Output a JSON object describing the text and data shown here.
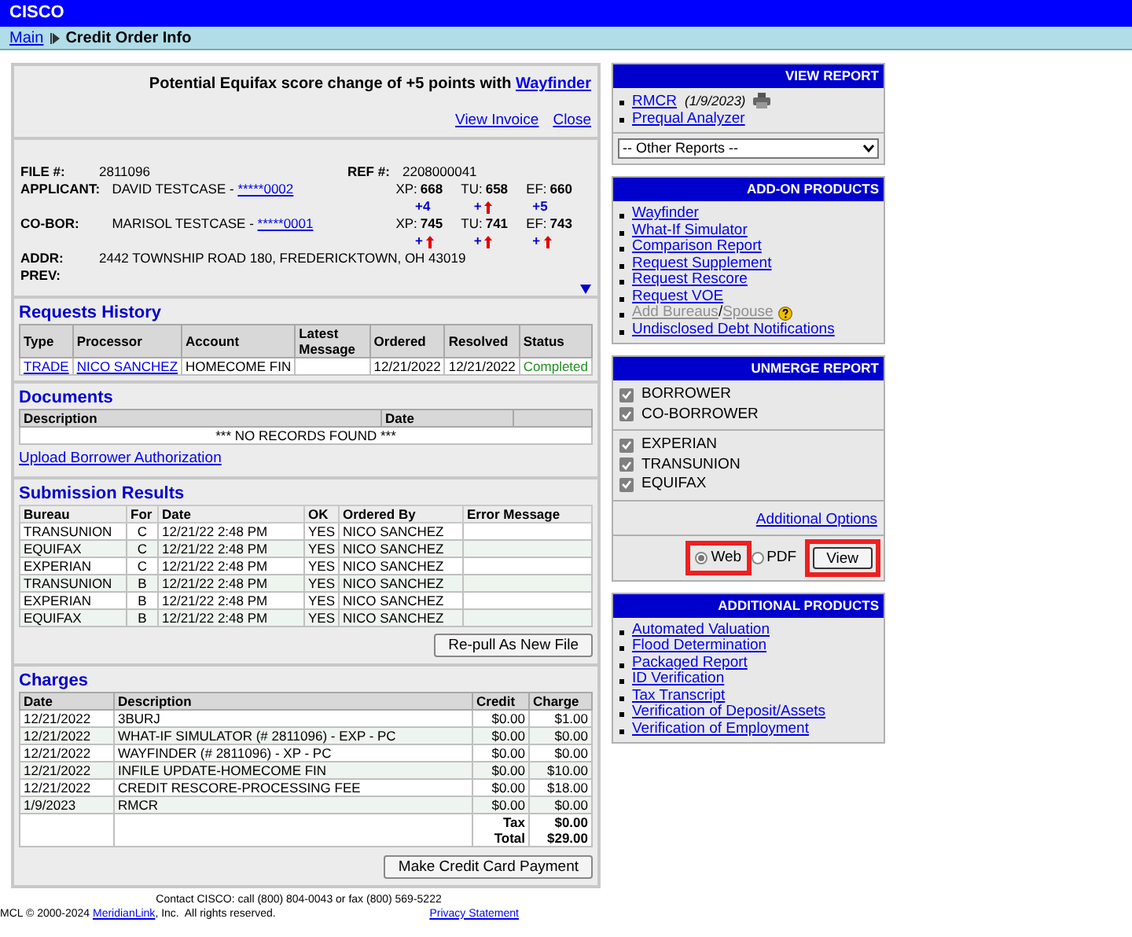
{
  "header": {
    "title": "CISCO"
  },
  "breadcrumb": {
    "link": "Main",
    "current": "Credit Order Info"
  },
  "promo": {
    "text": "Potential Equifax score change of +5 points with ",
    "link": "Wayfinder"
  },
  "top_links": [
    "View Invoice",
    "Close"
  ],
  "file": {
    "file_label": "FILE #:",
    "file": "2811096",
    "ref_label": "REF #:",
    "ref": "2208000041"
  },
  "borrowers": [
    {
      "label": "APPLICANT:",
      "name": "DAVID TESTCASE - ",
      "ssn": "*****0002",
      "scores": [
        {
          "bureau": "XP:",
          "score": "668",
          "change": "+4",
          "arrow": false
        },
        {
          "bureau": "TU:",
          "score": "658",
          "change": "+",
          "arrow": true
        },
        {
          "bureau": "EF:",
          "score": "660",
          "change": "+5",
          "arrow": false
        }
      ]
    },
    {
      "label": "CO-BOR:",
      "name": "MARISOL TESTCASE - ",
      "ssn": "*****0001",
      "scores": [
        {
          "bureau": "XP:",
          "score": "745",
          "change": "+",
          "arrow": true
        },
        {
          "bureau": "TU:",
          "score": "741",
          "change": "+",
          "arrow": true
        },
        {
          "bureau": "EF:",
          "score": "743",
          "change": "+",
          "arrow": true
        }
      ]
    }
  ],
  "addr": {
    "label": "ADDR:",
    "value": "2442 TOWNSHIP ROAD 180, FREDERICKTOWN, OH 43019",
    "prev_label": "PREV:"
  },
  "requests_history": {
    "title": "Requests History",
    "columns": [
      "Type",
      "Processor",
      "Account",
      "Latest Message",
      "Ordered",
      "Resolved",
      "Status"
    ],
    "rows": [
      {
        "type": "TRADE",
        "processor": "NICO SANCHEZ",
        "account": "HOMECOME FIN",
        "ordered": "12/21/2022",
        "resolved": "12/21/2022",
        "status": "Completed"
      }
    ]
  },
  "documents": {
    "title": "Documents",
    "columns": [
      "Description",
      "Date"
    ],
    "empty_message": "*** NO RECORDS FOUND ***",
    "link": "Upload Borrower Authorization"
  },
  "submission_results": {
    "title": "Submission Results",
    "columns": [
      "Bureau",
      "For",
      "Date",
      "OK",
      "Ordered By",
      "Error Message"
    ],
    "rows": [
      {
        "bureau": "TRANSUNION",
        "for": "C",
        "date": "12/21/22 2:48 PM",
        "ok": "YES",
        "ordered_by": "NICO SANCHEZ"
      },
      {
        "bureau": "EQUIFAX",
        "for": "C",
        "date": "12/21/22 2:48 PM",
        "ok": "YES",
        "ordered_by": "NICO SANCHEZ"
      },
      {
        "bureau": "EXPERIAN",
        "for": "C",
        "date": "12/21/22 2:48 PM",
        "ok": "YES",
        "ordered_by": "NICO SANCHEZ"
      },
      {
        "bureau": "TRANSUNION",
        "for": "B",
        "date": "12/21/22 2:48 PM",
        "ok": "YES",
        "ordered_by": "NICO SANCHEZ"
      },
      {
        "bureau": "EXPERIAN",
        "for": "B",
        "date": "12/21/22 2:48 PM",
        "ok": "YES",
        "ordered_by": "NICO SANCHEZ"
      },
      {
        "bureau": "EQUIFAX",
        "for": "B",
        "date": "12/21/22 2:48 PM",
        "ok": "YES",
        "ordered_by": "NICO SANCHEZ"
      }
    ],
    "button": "Re-pull As New File"
  },
  "charges": {
    "title": "Charges",
    "columns": [
      "Date",
      "Description",
      "Credit",
      "Charge"
    ],
    "rows": [
      {
        "date": "12/21/2022",
        "description": "3BURJ",
        "credit": "$0.00",
        "charge": "$1.00"
      },
      {
        "date": "12/21/2022",
        "description": "WHAT-IF SIMULATOR (# 2811096) - EXP - PC",
        "credit": "$0.00",
        "charge": "$0.00"
      },
      {
        "date": "12/21/2022",
        "description": "WAYFINDER (# 2811096) - XP - PC",
        "credit": "$0.00",
        "charge": "$0.00"
      },
      {
        "date": "12/21/2022",
        "description": "INFILE UPDATE-HOMECOME FIN",
        "credit": "$0.00",
        "charge": "$10.00"
      },
      {
        "date": "12/21/2022",
        "description": "CREDIT RESCORE-PROCESSING FEE",
        "credit": "$0.00",
        "charge": "$18.00"
      },
      {
        "date": "1/9/2023",
        "description": "RMCR",
        "credit": "$0.00",
        "charge": "$0.00"
      }
    ],
    "tax_label": "Tax",
    "tax": "$0.00",
    "total_label": "Total",
    "total": "$29.00",
    "button": "Make Credit Card Payment"
  },
  "footer": {
    "contact": "Contact CISCO: call (800) 804-0043 or fax (800) 569-5222",
    "copyright": "MCL © 2000-2024 ",
    "company_link": "MeridianLink",
    "rights": ", Inc.  All rights reserved.",
    "privacy_link": "Privacy Statement"
  },
  "view_report": {
    "title": "VIEW REPORT",
    "items": [
      {
        "label": "RMCR",
        "note": "(1/9/2023)",
        "printer": true
      },
      {
        "label": "Prequal Analyzer",
        "printer": false
      }
    ],
    "select": "-- Other Reports --"
  },
  "add_on": {
    "title": "ADD-ON PRODUCTS",
    "items": [
      {
        "kind": "link",
        "label": "Wayfinder"
      },
      {
        "kind": "link",
        "label": "What-If Simulator"
      },
      {
        "kind": "link",
        "label": "Comparison Report"
      },
      {
        "kind": "link",
        "label": "Request Supplement"
      },
      {
        "kind": "link",
        "label": "Request Rescore"
      },
      {
        "kind": "link",
        "label": "Request VOE"
      },
      {
        "kind": "split",
        "parts": [
          "Add Bureaus",
          "Spouse"
        ],
        "separator": "/",
        "disabled": true,
        "help": true
      },
      {
        "kind": "link",
        "label": "Undisclosed Debt Notifications"
      }
    ]
  },
  "unmerge": {
    "title": "UNMERGE REPORT",
    "groups": [
      [
        {
          "label": "BORROWER",
          "checked": true
        },
        {
          "label": "CO-BORROWER",
          "checked": true
        }
      ],
      [
        {
          "label": "EXPERIAN",
          "checked": true
        },
        {
          "label": "TRANSUNION",
          "checked": true
        },
        {
          "label": "EQUIFAX",
          "checked": true
        }
      ]
    ],
    "link": "Additional Options",
    "options": [
      {
        "label": "Web",
        "selected": true,
        "highlighted": true
      },
      {
        "label": "PDF",
        "selected": false,
        "highlighted": false
      }
    ],
    "button": {
      "label": "View",
      "highlighted": true
    }
  },
  "additional": {
    "title": "ADDITIONAL PRODUCTS",
    "items": [
      "Automated Valuation",
      "Flood Determination",
      "Packaged Report",
      "ID Verification",
      "Tax Transcript",
      "Verification of Deposit/Assets",
      "Verification of Employment"
    ]
  }
}
